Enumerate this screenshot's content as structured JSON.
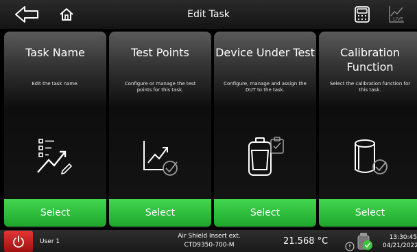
{
  "header": {
    "title": "Edit Task",
    "icons": [
      "back-arrow-icon",
      "home-icon",
      "calculator-icon",
      "live-icon"
    ],
    "live_label": "LIVE"
  },
  "cards": [
    {
      "title": "Task Name",
      "description": "Edit the task name.",
      "icon": "task-list-icon",
      "button": "Select"
    },
    {
      "title": "Test Points",
      "description": "Configure or manage the test points for this task.",
      "icon": "test-points-chart-icon",
      "button": "Select"
    },
    {
      "title": "Device Under Test",
      "description": "Configure, manage and assign the DUT to the task.",
      "icon": "dut-device-icon",
      "button": "Select"
    },
    {
      "title": "Calibration Function",
      "description": "Select the calibration function for this task.",
      "icon": "calibration-cylinder-icon",
      "button": "Select"
    }
  ],
  "status": {
    "user": "User 1",
    "insert_line1": "Air Shield Insert ext.",
    "insert_line2": "CTD9350-700-M",
    "temperature": "21.568 °C",
    "time": "13:30:45",
    "date": "04/21/2022"
  },
  "colors": {
    "select_green": "#2ebd3b",
    "power_red": "#d22b2b"
  }
}
